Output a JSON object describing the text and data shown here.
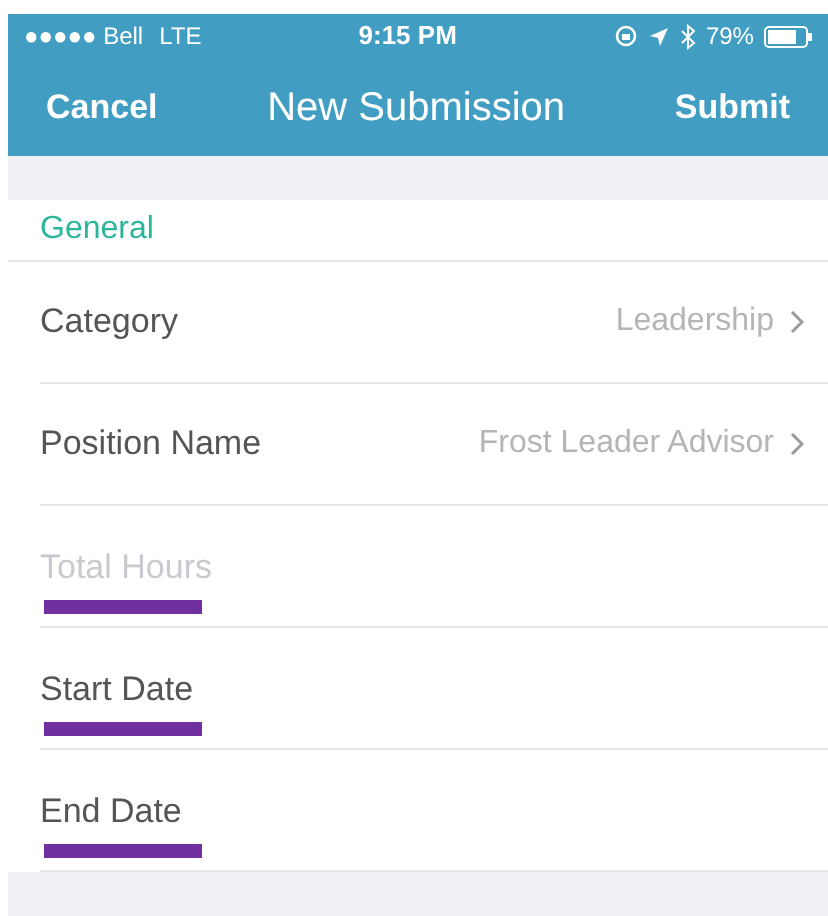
{
  "status_bar": {
    "carrier": "●●●●● Bell",
    "network": "LTE",
    "time": "9:15 PM",
    "battery": "79%"
  },
  "nav": {
    "cancel": "Cancel",
    "title": "New Submission",
    "submit": "Submit"
  },
  "section": {
    "title": "General"
  },
  "rows": [
    {
      "kind": "picker",
      "label": "Category",
      "value": "Leadership",
      "underlined": false
    },
    {
      "kind": "picker",
      "label": "Position Name",
      "value": "Frost Leader Advisor",
      "underlined": false
    },
    {
      "kind": "input",
      "placeholder": "Total Hours",
      "underlined": true
    },
    {
      "kind": "date",
      "label": "Start Date",
      "underlined": true
    },
    {
      "kind": "date",
      "label": "End Date",
      "underlined": true
    }
  ]
}
